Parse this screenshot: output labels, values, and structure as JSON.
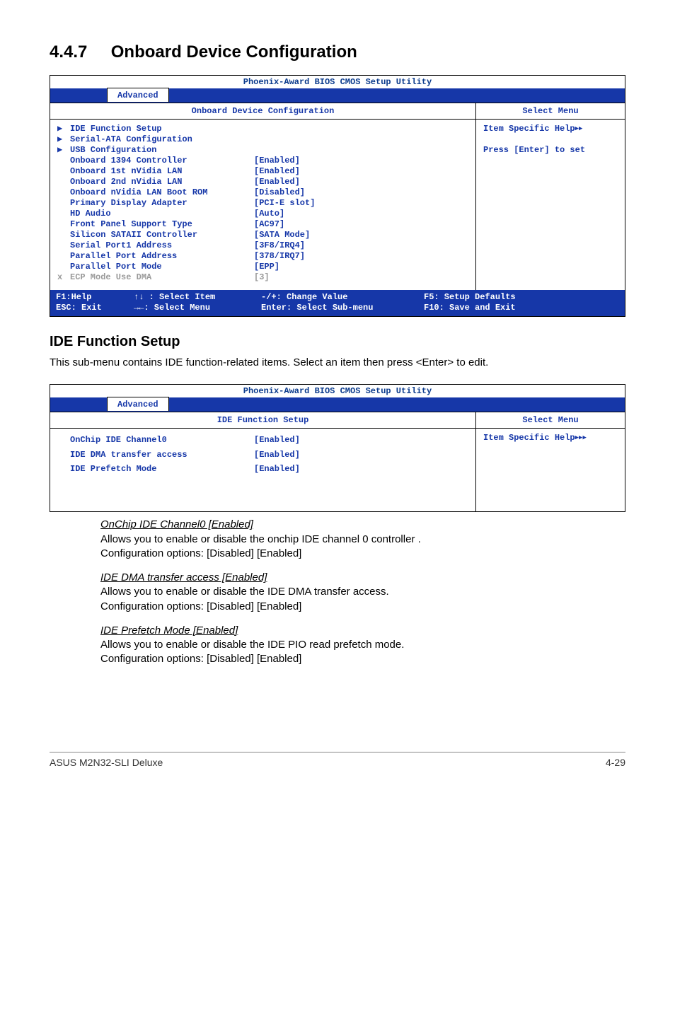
{
  "heading": {
    "number": "4.4.7",
    "title": "Onboard Device Configuration"
  },
  "bios1": {
    "title": "Phoenix-Award BIOS CMOS Setup Utility",
    "tab": "Advanced",
    "left_header": "Onboard Device Configuration",
    "right_header": "Select Menu",
    "help_line1": "Item Specific Help",
    "help_line2": "Press [Enter] to set",
    "rows": [
      {
        "marker": "▶",
        "label": "IDE Function Setup",
        "value": ""
      },
      {
        "marker": "▶",
        "label": "Serial-ATA Configuration",
        "value": ""
      },
      {
        "marker": "▶",
        "label": "USB Configuration",
        "value": ""
      },
      {
        "marker": "",
        "label": "Onboard 1394 Controller",
        "value": "[Enabled]"
      },
      {
        "marker": "",
        "label": "Onboard 1st nVidia LAN",
        "value": "[Enabled]"
      },
      {
        "marker": "",
        "label": "Onboard 2nd nVidia LAN",
        "value": "[Enabled]"
      },
      {
        "marker": "",
        "label": "Onboard nVidia LAN Boot ROM",
        "value": "[Disabled]"
      },
      {
        "marker": "",
        "label": "Primary Display Adapter",
        "value": "[PCI-E slot]"
      },
      {
        "marker": "",
        "label": "HD Audio",
        "value": "[Auto]"
      },
      {
        "marker": "",
        "label": "Front Panel Support Type",
        "value": "[AC97]"
      },
      {
        "marker": "",
        "label": "Silicon SATAII Controller",
        "value": "[SATA Mode]"
      },
      {
        "marker": "",
        "label": "Serial Port1 Address",
        "value": "[3F8/IRQ4]"
      },
      {
        "marker": "",
        "label": "Parallel Port Address",
        "value": "[378/IRQ7]"
      },
      {
        "marker": "",
        "label": "Parallel Port Mode",
        "value": "[EPP]"
      },
      {
        "marker": "x",
        "label": "ECP Mode Use DMA",
        "value": "[3]",
        "disabled": true
      }
    ],
    "footer": {
      "c1a": "F1:Help",
      "c1b": "ESC: Exit",
      "c2a": "↑↓ : Select Item",
      "c2b": "→←: Select Menu",
      "c3a": "-/+: Change Value",
      "c3b": "Enter: Select Sub-menu",
      "c4a": "F5: Setup Defaults",
      "c4b": "F10: Save and Exit"
    }
  },
  "ide_section": {
    "title": "IDE Function Setup",
    "desc": "This sub-menu contains IDE function-related items. Select an item then press <Enter> to edit."
  },
  "bios2": {
    "title": "Phoenix-Award BIOS CMOS Setup Utility",
    "tab": "Advanced",
    "left_header": "IDE Function Setup",
    "right_header": "Select Menu",
    "help_line1": "Item Specific Help",
    "rows": [
      {
        "marker": "",
        "label": "OnChip IDE Channel0",
        "value": "[Enabled]"
      },
      {
        "marker": "",
        "label": "IDE DMA transfer access",
        "value": "[Enabled]"
      },
      {
        "marker": "",
        "label": "IDE Prefetch Mode",
        "value": "[Enabled]"
      }
    ]
  },
  "options": [
    {
      "title": "OnChip IDE Channel0 [Enabled]",
      "line1": "Allows you to enable or disable the onchip IDE channel 0 controller .",
      "line2": "Configuration options: [Disabled] [Enabled]"
    },
    {
      "title": "IDE DMA transfer access [Enabled]",
      "line1": "Allows you to enable or disable the IDE DMA transfer access.",
      "line2": "Configuration options: [Disabled] [Enabled]"
    },
    {
      "title": "IDE Prefetch Mode [Enabled]",
      "line1": "Allows you to enable or disable the IDE PIO read prefetch mode.",
      "line2": "Configuration options: [Disabled] [Enabled]"
    }
  ],
  "footer": {
    "left": "ASUS M2N32-SLI Deluxe",
    "right": "4-29"
  }
}
